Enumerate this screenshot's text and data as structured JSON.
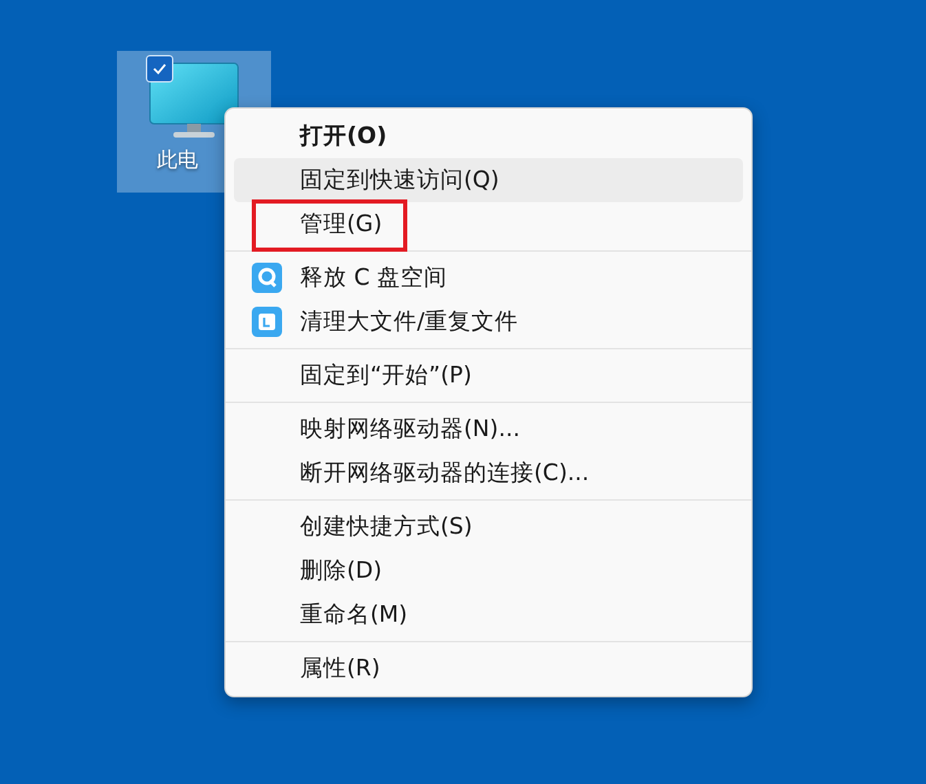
{
  "desktop_icon": {
    "label": "此电",
    "selected": true,
    "checked": true
  },
  "menu": {
    "groups": [
      {
        "items": [
          {
            "label": "打开(O)",
            "kind": "default",
            "selected": false,
            "annotated": false
          },
          {
            "label": "固定到快速访问(Q)",
            "kind": "plain",
            "selected": true,
            "annotated": false
          },
          {
            "label": "管理(G)",
            "kind": "plain",
            "selected": false,
            "annotated": true
          }
        ]
      },
      {
        "items": [
          {
            "label": "释放 C 盘空间",
            "kind": "app",
            "selected": false,
            "annotated": false
          },
          {
            "label": "清理大文件/重复文件",
            "kind": "app",
            "selected": false,
            "annotated": false
          }
        ]
      },
      {
        "items": [
          {
            "label": "固定到“开始”(P)",
            "kind": "plain",
            "selected": false,
            "annotated": false
          }
        ]
      },
      {
        "items": [
          {
            "label": "映射网络驱动器(N)...",
            "kind": "plain",
            "selected": false,
            "annotated": false
          },
          {
            "label": "断开网络驱动器的连接(C)...",
            "kind": "plain",
            "selected": false,
            "annotated": false
          }
        ]
      },
      {
        "items": [
          {
            "label": "创建快捷方式(S)",
            "kind": "plain",
            "selected": false,
            "annotated": false
          },
          {
            "label": "删除(D)",
            "kind": "plain",
            "selected": false,
            "annotated": false
          },
          {
            "label": "重命名(M)",
            "kind": "plain",
            "selected": false,
            "annotated": false
          }
        ]
      },
      {
        "items": [
          {
            "label": "属性(R)",
            "kind": "plain",
            "selected": false,
            "annotated": false
          }
        ]
      }
    ]
  }
}
